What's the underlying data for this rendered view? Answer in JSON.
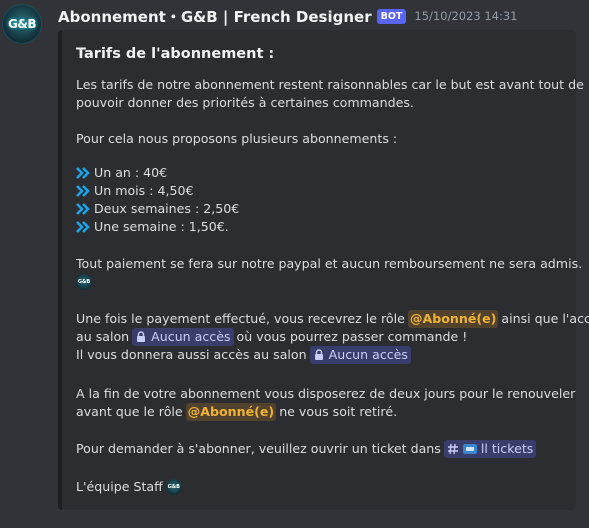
{
  "message": {
    "avatar_text": "G&B",
    "username": "Abonnement・G&B | French Designer",
    "bot_tag": "BOT",
    "timestamp": "15/10/2023 14:31"
  },
  "embed": {
    "title": "Tarifs de l'abonnement :",
    "intro_line1": "Les tarifs de notre abonnement restent raisonnables car le but est avant tout de",
    "intro_line2": "pouvoir donner des priorités à certaines commandes.",
    "offers_intro": "Pour cela nous proposons plusieurs abonnements :",
    "offers": [
      "Un an : 40€",
      "Un mois : 4,50€",
      "Deux semaines : 2,50€",
      "Une semaine : 1,50€."
    ],
    "payment_line": "Tout paiement se fera sur notre paypal et aucun remboursement ne sera admis.",
    "role_line1_a": "Une fois le payement effectué, vous recevrez le rôle",
    "role_mention": "@Abonné(e)",
    "role_line1_b": "ainsi que l'accès",
    "role_line2_a": "au salon",
    "locked_channel": "Aucun accès",
    "role_line2_b": "où vous pourrez passer commande !",
    "access_line_a": "Il vous donnera aussi accès au salon",
    "renew_line1": "A la fin de votre abonnement vous disposerez de deux jours pour le renouveler",
    "renew_line2_a": "avant que le rôle",
    "renew_line2_b": "ne vous soit retiré.",
    "ticket_line_a": "Pour demander à s'abonner, veuillez ouvrir un ticket dans",
    "ticket_channel": "ll tickets",
    "signature": "L'équipe Staff",
    "mini_logo_text": "G&B"
  },
  "colors": {
    "background": "#313338",
    "embed_bg": "#2b2d31",
    "arrow": "#1fa3e6",
    "mention": "#f0b232",
    "bot_tag": "#5865f2"
  }
}
